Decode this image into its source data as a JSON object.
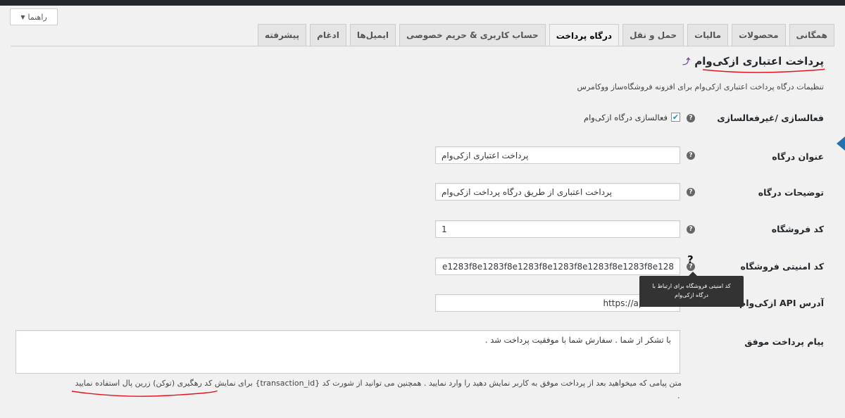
{
  "help": {
    "label": "راهنما"
  },
  "tabs": [
    {
      "label": "همگانی"
    },
    {
      "label": "محصولات"
    },
    {
      "label": "مالیات"
    },
    {
      "label": "حمل و نقل"
    },
    {
      "label": "درگاه پرداخت"
    },
    {
      "label": "حساب کاربری & حریم خصوصی"
    },
    {
      "label": "ایمیل‌ها"
    },
    {
      "label": "ادغام"
    },
    {
      "label": "پیشرفته"
    }
  ],
  "section": {
    "title": "پرداخت اعتباری ازکی‌وام",
    "return_icon": "⤴",
    "description": "تنظیمات درگاه پرداخت اعتباری ازکی‌وام برای افزونه فروشگاه‌ساز ووکامرس"
  },
  "fields": {
    "enable": {
      "label": "فعالسازی /غیرفعالسازی",
      "checkbox_label": "فعالسازی درگاه ازکی‌وام",
      "checked": true
    },
    "title": {
      "label": "عنوان درگاه",
      "value": "پرداخت اعتباری ازکی‌وام"
    },
    "description": {
      "label": "توضیحات درگاه",
      "value": "پرداخت اعتباری از طریق درگاه پرداخت ازکی‌وام"
    },
    "merchant_code": {
      "label": "کد فروشگاه",
      "value": "1"
    },
    "security_code": {
      "label": "کد امنیتی فروشگاه",
      "value": "e1283f8e1283f8e1283f8e1283f8e1283f8e1283f8e128"
    },
    "api_address": {
      "label": "آدرس API ازکی‌وام",
      "value": "https://api.azki..."
    },
    "success_message": {
      "label": "پیام پرداخت موفق",
      "value": "با تشکر از شما . سفارش شما با موفقیت پرداخت شد ."
    }
  },
  "tooltip": {
    "text": "کد امنیتی فروشگاه برای ارتباط با درگاه ازکی‌وام",
    "question_mark": "?"
  },
  "note": {
    "text": "متن پیامی که میخواهید بعد از پرداخت موفق به کاربر نمایش دهید را وارد نمایید . همچنین می توانید از شورت کد {transaction_id} برای نمایش کد رهگیری (توکن) زرین پال استفاده نمایید",
    "end": "."
  },
  "colors": {
    "accent": "#2271b1",
    "annotation": "#e0141e",
    "tooltip_bg": "#333333"
  }
}
